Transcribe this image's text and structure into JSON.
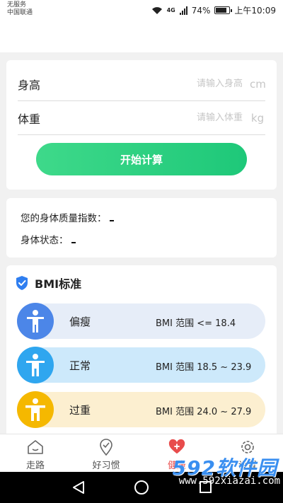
{
  "status_bar": {
    "carrier_line1": "无服务",
    "carrier_line2": "中国联通",
    "network": "4G",
    "battery": "74%",
    "time": "上午10:09"
  },
  "input_card": {
    "height_label": "身高",
    "height_placeholder": "请输入身高",
    "height_unit": "cm",
    "weight_label": "体重",
    "weight_placeholder": "请输入体重",
    "weight_unit": "kg",
    "calc_button": "开始计算"
  },
  "result_card": {
    "bmi_label": "您的身体质量指数：",
    "status_label": "身体状态："
  },
  "bmi_standard": {
    "title": "BMI标准",
    "rows": [
      {
        "label": "偏瘦",
        "range": "BMI 范围 <= 18.4"
      },
      {
        "label": "正常",
        "range": "BMI 范围 18.5 ~ 23.9"
      },
      {
        "label": "过重",
        "range": "BMI 范围 24.0 ~ 27.9"
      }
    ]
  },
  "tabbar": {
    "items": [
      {
        "label": "走路",
        "icon": "home-icon"
      },
      {
        "label": "好习惯",
        "icon": "location-check-icon"
      },
      {
        "label": "健康",
        "icon": "heart-plus-icon"
      },
      {
        "label": "设置",
        "icon": "gear-icon"
      }
    ],
    "active_index": 2
  },
  "watermark": {
    "brand": "592软件园",
    "url": "www.592xiazai.com"
  },
  "colors": {
    "accent_green": "#1ec879",
    "underweight": "#4c86e8",
    "normal": "#2fa6ef",
    "overweight": "#f5b800",
    "active_tab": "#e84c4c"
  }
}
